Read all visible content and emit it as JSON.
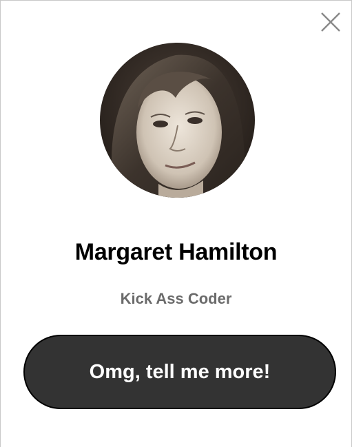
{
  "profile": {
    "name": "Margaret Hamilton",
    "subtitle": "Kick Ass Coder",
    "photo_icon": "portrait-photo"
  },
  "actions": {
    "close_icon": "close-icon",
    "cta_label": "Omg, tell me more!"
  },
  "colors": {
    "background": "#ffffff",
    "name_text": "#000000",
    "subtitle_text": "#6b6b6b",
    "button_bg": "#333333",
    "button_text": "#ffffff",
    "close_icon": "#8a8a8a"
  }
}
